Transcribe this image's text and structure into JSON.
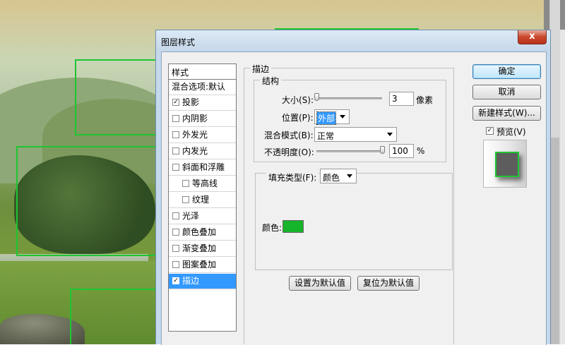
{
  "dialog": {
    "title": "图层样式",
    "close_glyph": "x"
  },
  "style_list": {
    "header": "样式",
    "blend_options": "混合选项:默认",
    "items": [
      {
        "label": "投影",
        "checked": true,
        "selected": false,
        "indent": false
      },
      {
        "label": "内阴影",
        "checked": false,
        "selected": false,
        "indent": false
      },
      {
        "label": "外发光",
        "checked": false,
        "selected": false,
        "indent": false
      },
      {
        "label": "内发光",
        "checked": false,
        "selected": false,
        "indent": false
      },
      {
        "label": "斜面和浮雕",
        "checked": false,
        "selected": false,
        "indent": false
      },
      {
        "label": "等高线",
        "checked": false,
        "selected": false,
        "indent": true
      },
      {
        "label": "纹理",
        "checked": false,
        "selected": false,
        "indent": true
      },
      {
        "label": "光泽",
        "checked": false,
        "selected": false,
        "indent": false
      },
      {
        "label": "颜色叠加",
        "checked": false,
        "selected": false,
        "indent": false
      },
      {
        "label": "渐变叠加",
        "checked": false,
        "selected": false,
        "indent": false
      },
      {
        "label": "图案叠加",
        "checked": false,
        "selected": false,
        "indent": false
      },
      {
        "label": "描边",
        "checked": true,
        "selected": true,
        "indent": false
      }
    ]
  },
  "stroke": {
    "group_title": "描边",
    "structure_title": "结构",
    "size_label": "大小(S):",
    "size_value": "3",
    "size_unit": "像素",
    "size_fraction": 0.0,
    "position_label": "位置(P):",
    "position_value": "外部",
    "blend_mode_label": "混合模式(B):",
    "blend_mode_value": "正常",
    "opacity_label": "不透明度(O):",
    "opacity_value": "100",
    "opacity_unit": "%",
    "opacity_fraction": 1.0,
    "fill_type_label": "填充类型(F):",
    "fill_type_value": "颜色",
    "color_label": "颜色:",
    "color_value": "#16b42a"
  },
  "buttons": {
    "make_default": "设置为默认值",
    "reset_default": "复位为默认值",
    "ok": "确定",
    "cancel": "取消",
    "new_style": "新建样式(W)...",
    "preview_label": "预览(V)",
    "preview_checked": true
  },
  "colors": {
    "selection": "#3399ff",
    "stroke_green": "#1ec532"
  }
}
